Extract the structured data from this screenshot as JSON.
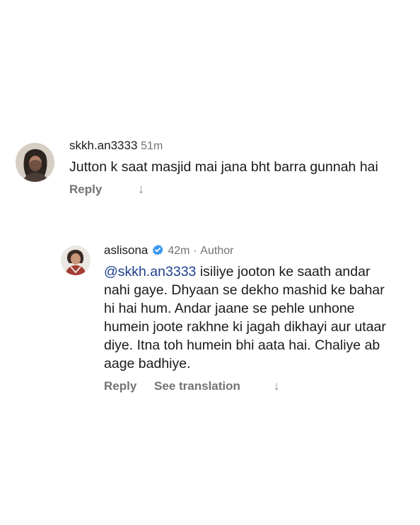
{
  "comments": [
    {
      "username": "skkh.an3333",
      "time": "51m",
      "text": "Jutton k saat masjid mai jana bht barra gunnah hai",
      "reply_label": "Reply",
      "arrow": "↓"
    },
    {
      "username": "aslisona",
      "time": "42m",
      "separator": "·",
      "role": "Author",
      "mention": "@skkh.an3333",
      "text": "isiliye jooton ke saath andar nahi gaye. Dhyaan se dekho mashid ke bahar hi hai hum. Andar jaane se pehle unhone humein joote rakhne ki jagah dikhayi aur utaar diye. Itna toh humein bhi aata hai. Chaliye ab aage badhiye.",
      "reply_label": "Reply",
      "translate_label": "See translation",
      "arrow": "↓"
    }
  ],
  "colors": {
    "verified_badge": "#3897f0",
    "mention": "#1f3f8f"
  },
  "icons": {
    "verified": "verified-badge-icon",
    "more": "down-arrow-icon"
  }
}
